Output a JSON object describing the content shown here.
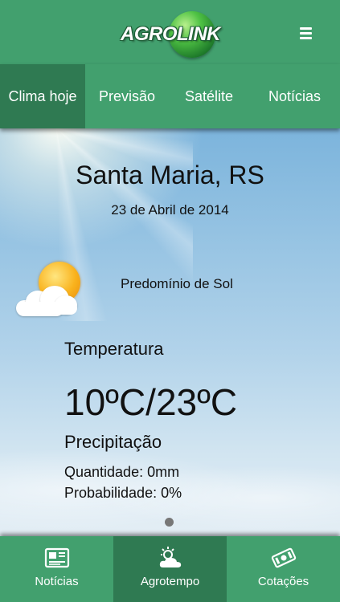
{
  "header": {
    "logo_text": "AGROLINK",
    "menu_icon": "hamburger-menu-icon"
  },
  "tabs": [
    {
      "label": "Clima hoje",
      "active": true
    },
    {
      "label": "Previsão",
      "active": false
    },
    {
      "label": "Satélite",
      "active": false
    },
    {
      "label": "Notícias",
      "active": false
    }
  ],
  "weather": {
    "city": "Santa Maria, RS",
    "date": "23 de Abril de 2014",
    "icon": "sun-behind-cloud-icon",
    "condition": "Predomínio de Sol",
    "temperature_label": "Temperatura",
    "temperature": "10ºC/23ºC",
    "precipitation_label": "Precipitação",
    "quantity": "Quantidade: 0mm",
    "probability": "Probabilidade: 0%"
  },
  "pager": {
    "pages": 1,
    "current": 1
  },
  "bottom_nav": [
    {
      "label": "Notícias",
      "icon": "newspaper-icon",
      "active": false
    },
    {
      "label": "Agrotempo",
      "icon": "sun-cloud-icon",
      "active": true
    },
    {
      "label": "Cotações",
      "icon": "money-icon",
      "active": false
    }
  ],
  "colors": {
    "bar_green": "#42a06e",
    "active_green": "#2f7a52",
    "sky_top": "#7cb4dc",
    "sky_bottom": "#e4eef5"
  }
}
